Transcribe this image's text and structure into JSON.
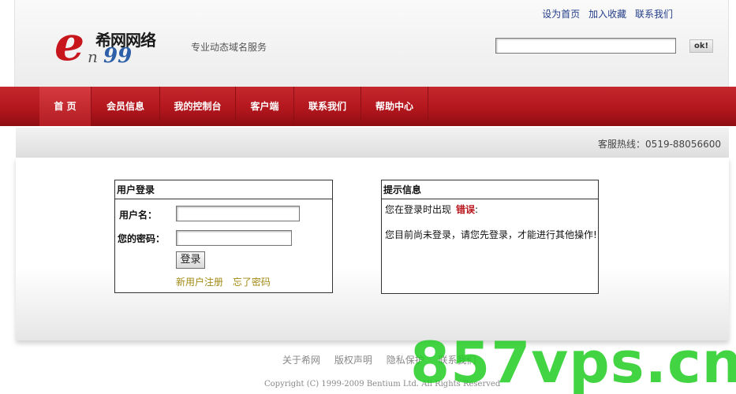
{
  "header": {
    "logo_cn": "希网网络",
    "logo_e": "e",
    "logo_n": "n",
    "logo_99": "99",
    "tagline": "专业动态域名服务",
    "top_links": [
      "设为首页",
      "加入收藏",
      "联系我们"
    ],
    "search_value": "",
    "ok_label": "ok!"
  },
  "nav": {
    "items": [
      "首 页",
      "会员信息",
      "我的控制台",
      "客户端",
      "联系我们",
      "帮助中心"
    ]
  },
  "hotline": "客服热线：0519-88056600",
  "login": {
    "title": "用户登录",
    "username_label": "用户名：",
    "username_value": "",
    "password_label": "您的密码：",
    "password_value": "",
    "submit_label": "登录",
    "register_link": "新用户注册",
    "forgot_link": "忘了密码"
  },
  "tip": {
    "title": "提示信息",
    "line1_prefix": "您在登录时出现",
    "line1_error": "错误",
    "line1_suffix": ":",
    "line2": "您目前尚未登录，请您先登录，才能进行其他操作!"
  },
  "footer": {
    "links": [
      "关于希网",
      "版权声明",
      "隐私保护",
      "联系我们"
    ],
    "copyright": "Copyright (C) 1999-2009 Bentium Ltd. All Rights Reserved"
  },
  "watermark": "857vps.cn"
}
